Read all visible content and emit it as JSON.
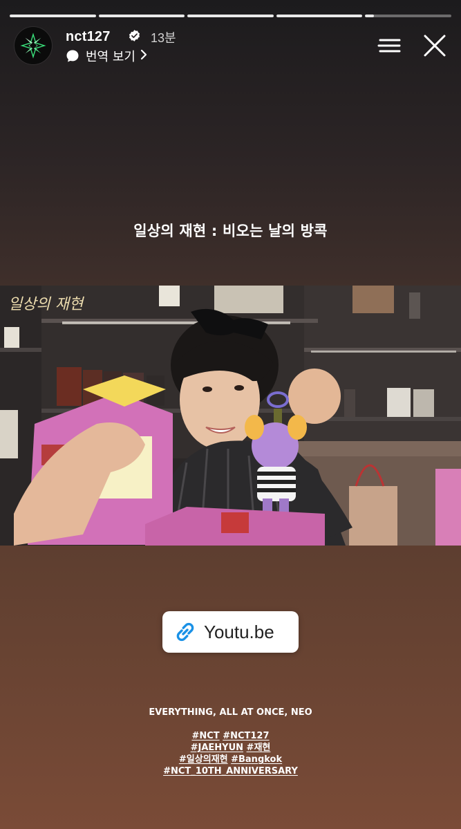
{
  "story": {
    "segments": [
      1,
      1,
      1,
      1,
      0.1
    ]
  },
  "header": {
    "username": "nct127",
    "time_ago": "13분",
    "translate_label": "번역 보기",
    "icons": {
      "avatar": "nct-logo-avatar",
      "verified": "verified-badge-icon",
      "translate": "speech-bubble-icon",
      "chevron": "chevron-right-icon",
      "menu": "menu-icon",
      "close": "close-icon"
    }
  },
  "content": {
    "title": "일상의 재현 : 비오는 날의 방콕",
    "photo_overlay_text": "일상의 재현",
    "link_sticker": {
      "label": "Youtu.be",
      "icon": "link-icon"
    },
    "caption": {
      "line1": "EVERYTHING, ALL AT ONCE, NEO",
      "hashtag_rows": [
        [
          "#NCT",
          "#NCT127"
        ],
        [
          "#JAEHYUN",
          "#재현"
        ],
        [
          "#일상의재현",
          "#Bangkok"
        ],
        [
          "#NCT_10TH_ANNIVERSARY"
        ]
      ]
    }
  },
  "colors": {
    "link_icon": "#1a91e6",
    "progress_active": "#e9e9e9"
  }
}
